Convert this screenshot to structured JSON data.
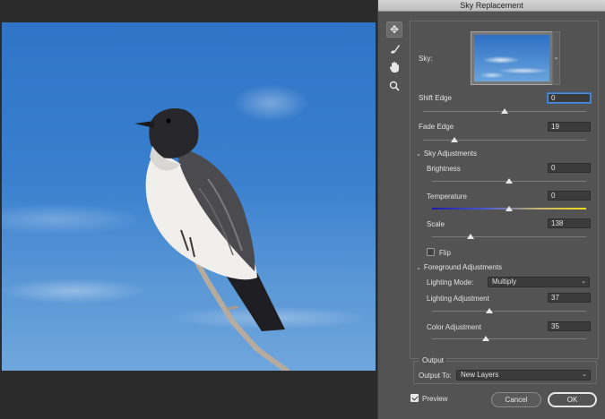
{
  "dialog": {
    "title": "Sky Replacement",
    "tools": [
      {
        "icon": "move-sky-icon",
        "glyph": "✥"
      },
      {
        "icon": "sky-brush-icon",
        "glyph": "🖌"
      },
      {
        "icon": "hand-icon",
        "glyph": "✋"
      },
      {
        "icon": "zoom-icon",
        "glyph": "⌕"
      }
    ],
    "sky_label": "Sky:",
    "shift_edge": {
      "label": "Shift Edge",
      "value": "0"
    },
    "fade_edge": {
      "label": "Fade Edge",
      "value": "19"
    },
    "sky_adjustments": {
      "label": "Sky Adjustments",
      "brightness": {
        "label": "Brightness",
        "value": "0"
      },
      "temperature": {
        "label": "Temperature",
        "value": "0"
      },
      "scale": {
        "label": "Scale",
        "value": "138"
      },
      "flip": {
        "label": "Flip",
        "checked": false
      }
    },
    "foreground_adjustments": {
      "label": "Foreground Adjustments",
      "lighting_mode": {
        "label": "Lighting Mode:",
        "value": "Multiply"
      },
      "lighting_adjustment": {
        "label": "Lighting Adjustment",
        "value": "37"
      },
      "color_adjustment": {
        "label": "Color Adjustment",
        "value": "35"
      }
    },
    "output": {
      "label": "Output",
      "output_to": {
        "label": "Output To:",
        "value": "New Layers"
      }
    },
    "preview": {
      "label": "Preview",
      "checked": true
    },
    "cancel_label": "Cancel",
    "ok_label": "OK"
  },
  "sliders": {
    "shift_edge": 0.5,
    "fade_edge": 0.19,
    "brightness": 0.5,
    "temperature": 0.5,
    "scale": 0.25,
    "lighting_adjustment": 0.37,
    "color_adjustment": 0.35
  },
  "colors": {
    "dialog_bg": "#535353",
    "focus_ring": "#4a8fe2",
    "sky_blue": "#2f74c6"
  }
}
